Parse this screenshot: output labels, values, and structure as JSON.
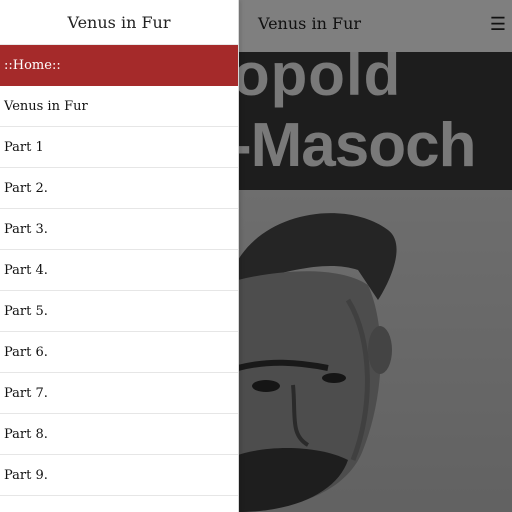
{
  "app": {
    "title": "Venus in Fur",
    "menu_icon": "hamburger-icon",
    "banner": {
      "line1": "opold",
      "line2": "-Masoch"
    }
  },
  "drawer": {
    "title": "Venus in Fur",
    "items": [
      {
        "label": "::Home::",
        "active": true
      },
      {
        "label": "Venus in Fur"
      },
      {
        "label": "Part 1"
      },
      {
        "label": "Part 2."
      },
      {
        "label": "Part 3."
      },
      {
        "label": "Part 4."
      },
      {
        "label": "Part 5."
      },
      {
        "label": "Part 6."
      },
      {
        "label": "Part 7."
      },
      {
        "label": "Part 8."
      },
      {
        "label": "Part 9."
      }
    ]
  },
  "colors": {
    "accent": "#a52a2a",
    "overlay": "rgba(0,0,0,0.5)"
  }
}
